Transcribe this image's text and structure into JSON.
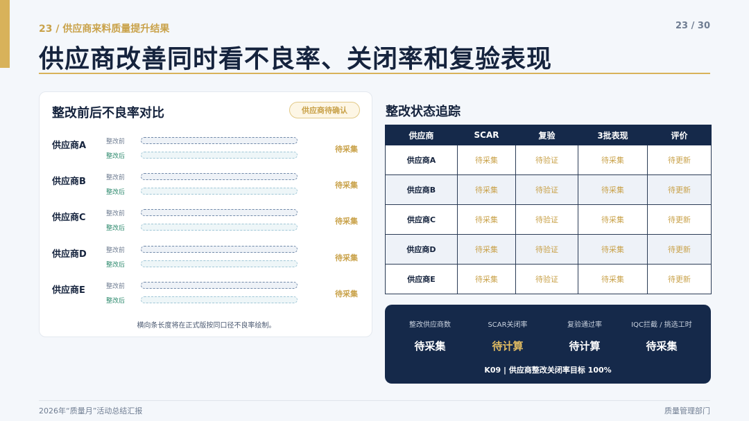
{
  "header": {
    "kicker": "23  /  供应商来料质量提升结果",
    "page_num": "23 / 30",
    "title": "供应商改善同时看不良率、关闭率和复验表现"
  },
  "left_card": {
    "title": "整改前后不良率对比",
    "badge": "供应商待确认",
    "before_label": "整改前",
    "after_label": "整改后",
    "suppliers": [
      {
        "name": "供应商A",
        "status": "待采集"
      },
      {
        "name": "供应商B",
        "status": "待采集"
      },
      {
        "name": "供应商C",
        "status": "待采集"
      },
      {
        "name": "供应商D",
        "status": "待采集"
      },
      {
        "name": "供应商E",
        "status": "待采集"
      }
    ],
    "note": "横向条长度将在正式版按同口径不良率绘制。"
  },
  "right": {
    "title": "整改状态追踪",
    "columns": [
      "供应商",
      "SCAR",
      "复验",
      "3批表现",
      "评价"
    ],
    "rows": [
      [
        "供应商A",
        "待采集",
        "待验证",
        "待采集",
        "待更新"
      ],
      [
        "供应商B",
        "待采集",
        "待验证",
        "待采集",
        "待更新"
      ],
      [
        "供应商C",
        "待采集",
        "待验证",
        "待采集",
        "待更新"
      ],
      [
        "供应商D",
        "待采集",
        "待验证",
        "待采集",
        "待更新"
      ],
      [
        "供应商E",
        "待采集",
        "待验证",
        "待采集",
        "待更新"
      ]
    ]
  },
  "kpis": {
    "items": [
      {
        "label": "整改供应商数",
        "value": "待采集"
      },
      {
        "label": "SCAR关闭率",
        "value": "待计算"
      },
      {
        "label": "复验通过率",
        "value": "待计算"
      },
      {
        "label": "IQC拦截 / 挑选工时",
        "value": "待采集"
      }
    ],
    "target": "K09 | 供应商整改关闭率目标 100%"
  },
  "footer": {
    "left": "2026年“质量月”活动总结汇报",
    "right": "质量管理部门"
  },
  "colors": {
    "accent_gold": "#d8b25a",
    "navy": "#15294a",
    "after_green": "#2e8a6e"
  }
}
